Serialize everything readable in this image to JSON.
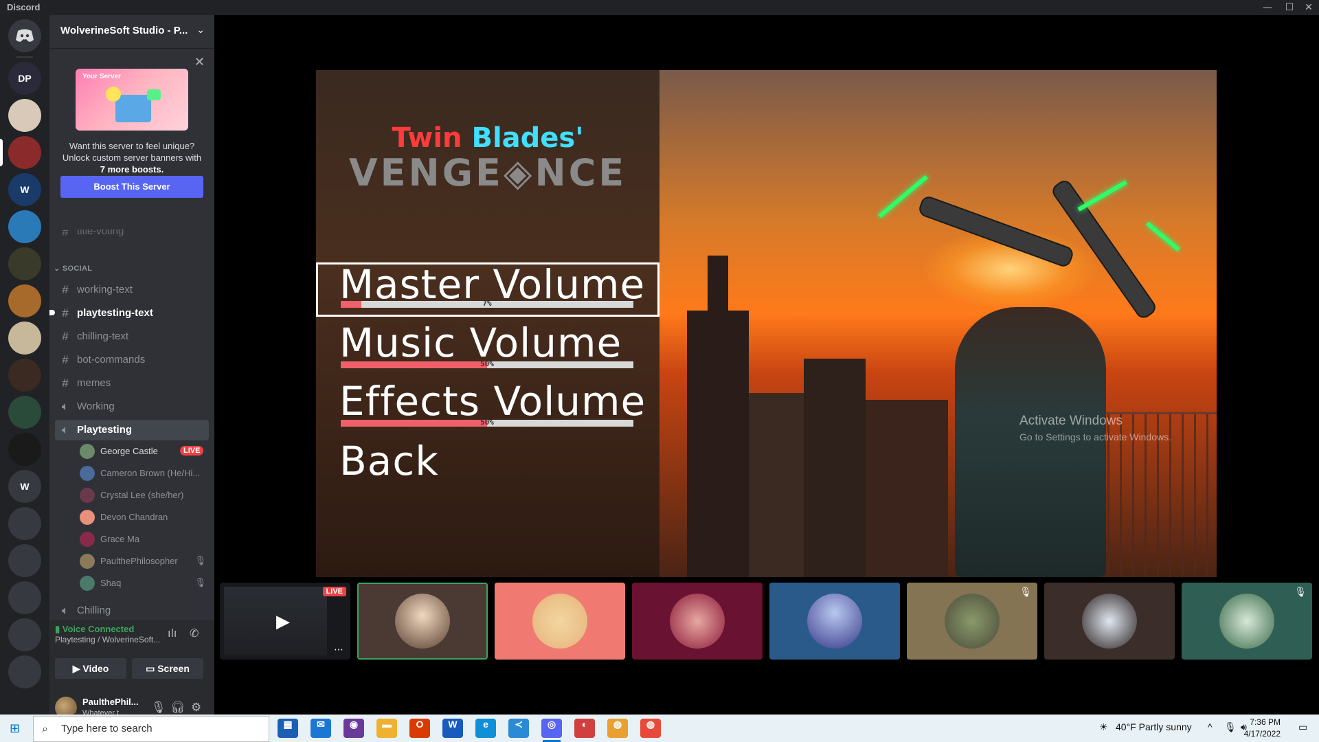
{
  "window": {
    "app_title": "Discord"
  },
  "server": {
    "name": "WolverineSoft Studio - P..."
  },
  "rail_servers": [
    {
      "label": "DP",
      "color": "#2a2a3a"
    },
    {
      "label": "",
      "color": "#d9c9b8"
    },
    {
      "label": "",
      "color": "#8a2a2a"
    },
    {
      "label": "W",
      "color": "#1a3a6a"
    },
    {
      "label": "",
      "color": "#2a7ab8"
    },
    {
      "label": "",
      "color": "#3a3a2a"
    },
    {
      "label": "",
      "color": "#a86a2a"
    },
    {
      "label": "",
      "color": "#c8b89a"
    },
    {
      "label": "",
      "color": "#3a2a22"
    },
    {
      "label": "",
      "color": "#2a4a3a"
    },
    {
      "label": "",
      "color": "#1a1a1a"
    },
    {
      "label": "W",
      "color": "#36393f"
    },
    {
      "label": "",
      "color": "#36393f"
    },
    {
      "label": "",
      "color": "#36393f"
    },
    {
      "label": "",
      "color": "#36393f"
    },
    {
      "label": "",
      "color": "#36393f"
    },
    {
      "label": "",
      "color": "#36393f"
    }
  ],
  "boost_card": {
    "banner_label": "Your Server",
    "line1": "Want this server to feel unique?",
    "line2": "Unlock custom server banners with",
    "line3": "7 more boosts.",
    "button": "Boost This Server"
  },
  "channels": {
    "partial_above": "title-voting",
    "category": "SOCIAL",
    "text": [
      "working-text",
      "playtesting-text",
      "chilling-text",
      "bot-commands",
      "memes"
    ],
    "voice_working": "Working",
    "voice_playtesting": "Playtesting",
    "voice_chilling": "Chilling",
    "live_badge": "LIVE",
    "voice_users": [
      "George Castle",
      "Cameron Brown (He/Hi...",
      "Crystal Lee (she/her)",
      "Devon Chandran",
      "Grace Ma",
      "PaulthePhilosopher",
      "Shaq"
    ]
  },
  "voice_panel": {
    "status": "Voice Connected",
    "channel": "Playtesting / WolverineSoft...",
    "video": "Video",
    "screen": "Screen"
  },
  "user_panel": {
    "name": "PaulthePhil...",
    "status": "Whatever t..."
  },
  "game": {
    "title_red": "Twin",
    "title_blue": "Blades'",
    "title_sub": "VENGE◈NCE",
    "menu": [
      {
        "label": "Master Volume",
        "percent_text": "7%",
        "fill": 0.07
      },
      {
        "label": "Music Volume",
        "percent_text": "50%",
        "fill": 0.5
      },
      {
        "label": "Effects Volume",
        "percent_text": "50%",
        "fill": 0.5
      },
      {
        "label": "Back"
      }
    ],
    "watermark_title": "Activate Windows",
    "watermark_sub": "Go to Settings to activate Windows."
  },
  "tiles": {
    "live_badge": "LIVE",
    "colors": [
      "#18191c",
      "#4a3a33",
      "#f07a72",
      "#6a1232",
      "#2a5a8a",
      "#857453",
      "#3a2d2a",
      "#2f5f54"
    ]
  },
  "taskbar": {
    "search_placeholder": "Type here to search",
    "weather": "40°F  Partly sunny",
    "time": "7:36 PM",
    "date": "4/17/2022"
  }
}
